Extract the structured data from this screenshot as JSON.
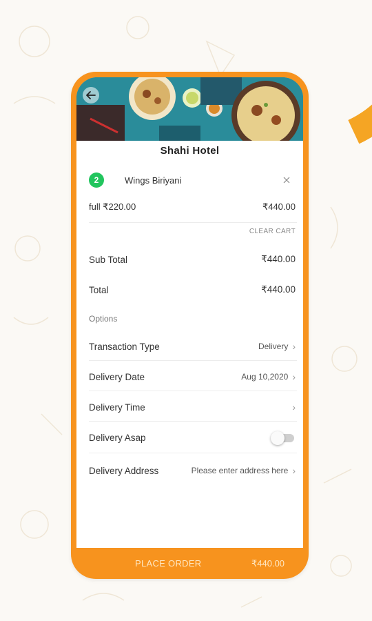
{
  "restaurant": {
    "name": "Shahi Hotel"
  },
  "cart_item": {
    "quantity": "2",
    "name": "Wings Biriyani",
    "variant": "full ₹220.00",
    "line_total": "₹440.00"
  },
  "actions": {
    "clear_cart": "CLEAR CART"
  },
  "summary": {
    "subtotal_label": "Sub Total",
    "subtotal_value": "₹440.00",
    "total_label": "Total",
    "total_value": "₹440.00"
  },
  "options": {
    "heading": "Options",
    "transaction_type_label": "Transaction Type",
    "transaction_type_value": "Delivery",
    "delivery_date_label": "Delivery Date",
    "delivery_date_value": "Aug 10,2020",
    "delivery_time_label": "Delivery Time",
    "delivery_asap_label": "Delivery Asap",
    "delivery_asap_on": false,
    "delivery_address_label": "Delivery Address",
    "delivery_address_placeholder": "Please enter address here"
  },
  "footer": {
    "place_order_label": "PLACE ORDER",
    "order_amount": "₹440.00"
  },
  "colors": {
    "accent": "#f7931e",
    "badge": "#22c55e",
    "hero_bg": "#1f7f8f"
  },
  "icons": {
    "back": "arrow-left-icon",
    "remove": "close-icon",
    "chevron": "chevron-right-icon"
  }
}
